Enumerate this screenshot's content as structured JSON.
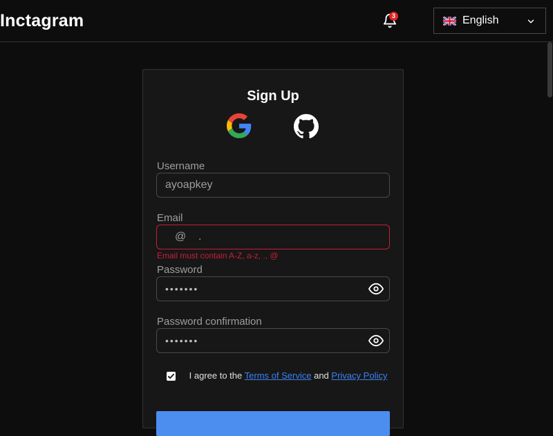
{
  "app": {
    "logo": "Inctagram"
  },
  "header": {
    "notifications_count": "3",
    "language": {
      "selected": "English",
      "flag": "uk-flag-icon"
    }
  },
  "signup": {
    "title": "Sign Up",
    "oauth": [
      "google-icon",
      "github-icon"
    ],
    "username": {
      "label": "Username",
      "value": "ayoapkey"
    },
    "email": {
      "label": "Email",
      "value": "@    .",
      "error": "Email must contain A-Z, a-z, ., @"
    },
    "password": {
      "label": "Password",
      "value": "•••••••"
    },
    "password_confirmation": {
      "label": "Password confirmation",
      "value": "•••••••"
    },
    "agree": {
      "checked": true,
      "prefix": "I agree to the",
      "terms": "Terms of Service",
      "and": "and",
      "privacy": "Privacy Policy"
    }
  },
  "colors": {
    "background": "#0d0d0d",
    "card": "#171717",
    "error": "#c81e3a",
    "link": "#3b82f6",
    "primary": "#4b8ef0",
    "badge": "#e02424"
  }
}
